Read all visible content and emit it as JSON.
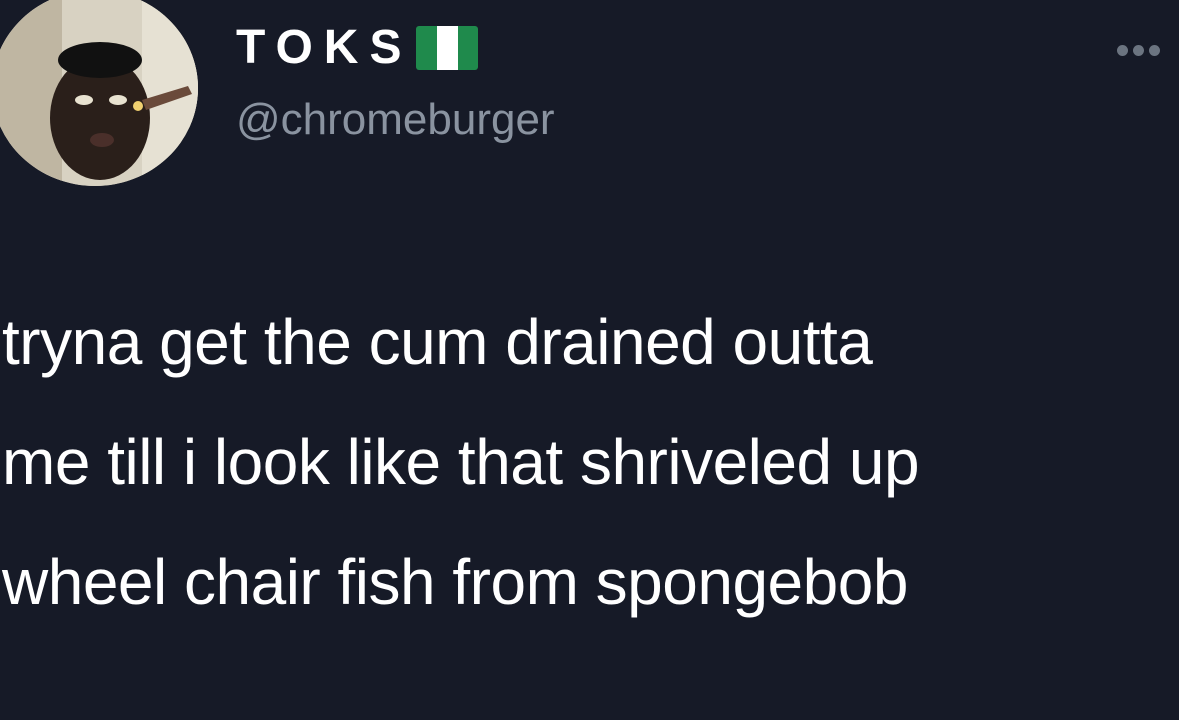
{
  "tweet": {
    "display_name": "TOKS",
    "handle": "@chromeburger",
    "flag_icon": "nigeria-flag-icon",
    "flag_colors": [
      "#1f8a4c",
      "#ffffff",
      "#1f8a4c"
    ],
    "more_icon": "more-options-icon",
    "avatar_icon": "profile-avatar",
    "text_lines": [
      "tryna get the cum drained outta",
      "me till i look like that shriveled up",
      "wheel chair fish from spongebob"
    ]
  },
  "colors": {
    "background": "#161a27",
    "text": "#ffffff",
    "handle": "#8a93a0"
  }
}
